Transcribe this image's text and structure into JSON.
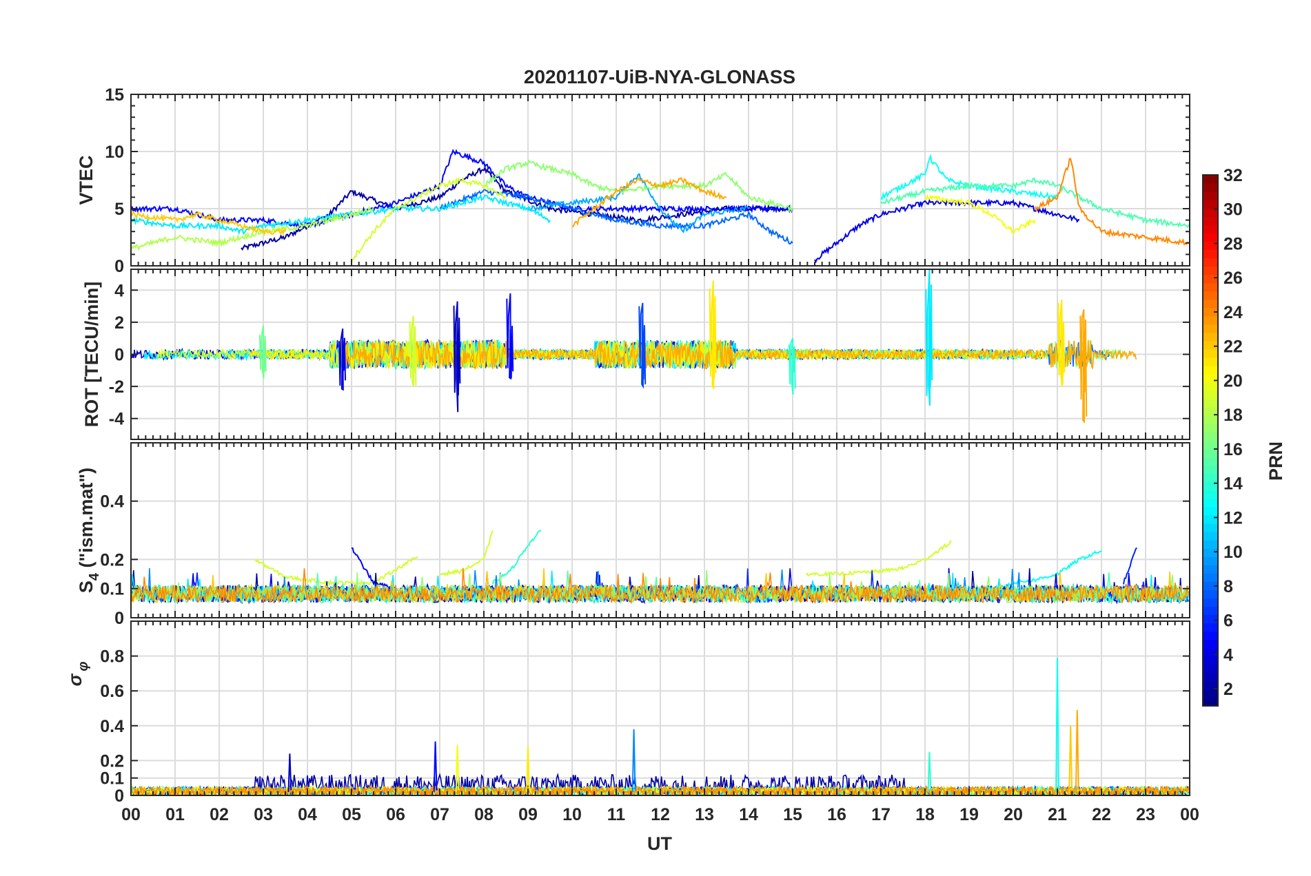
{
  "chart_data": {
    "type": "line",
    "title": "20201107-UiB-NYA-GLONASS",
    "xlabel": "UT",
    "xlim": [
      0,
      24
    ],
    "x_tick_labels": [
      "00",
      "01",
      "02",
      "03",
      "04",
      "05",
      "06",
      "07",
      "08",
      "09",
      "10",
      "11",
      "12",
      "13",
      "14",
      "15",
      "16",
      "17",
      "18",
      "19",
      "20",
      "21",
      "22",
      "23",
      "00"
    ],
    "grid": true,
    "colorbar": {
      "label": "PRN",
      "range": [
        1,
        32
      ],
      "tick_labels": [
        "2",
        "4",
        "6",
        "8",
        "10",
        "12",
        "14",
        "16",
        "18",
        "20",
        "22",
        "24",
        "26",
        "28",
        "30",
        "32"
      ],
      "colormap": "jet",
      "position": "right"
    },
    "panels": [
      {
        "name": "vtec",
        "ylabel": "VTEC",
        "ylim": [
          0,
          15
        ],
        "y_tick_labels": [
          "0",
          "5",
          "10",
          "15"
        ],
        "series": [
          {
            "prn": 2,
            "x": [
              2.5,
              3.5,
              4.5,
              5.0,
              6.0,
              7.0,
              7.5,
              8.0,
              8.5,
              9.5,
              10.5,
              11.5,
              12.5,
              13.5,
              14.5,
              15.0
            ],
            "y": [
              1.5,
              2.5,
              4.5,
              6.5,
              5.0,
              6.0,
              7.5,
              8.5,
              6.5,
              5.0,
              4.5,
              4.0,
              4.5,
              5.0,
              5.0,
              5.0
            ]
          },
          {
            "prn": 4,
            "x": [
              15.5,
              16.0,
              16.5,
              17.0,
              18.0,
              19.0,
              20.0,
              21.0,
              21.5
            ],
            "y": [
              0.5,
              2.0,
              3.5,
              4.5,
              5.5,
              5.5,
              5.5,
              4.5,
              4.0
            ]
          },
          {
            "prn": 5,
            "x": [
              0.0,
              1.0,
              2.0,
              3.0,
              4.0,
              5.0,
              6.0,
              7.0,
              7.3,
              8.0,
              8.5,
              9.0,
              10.0,
              11.0,
              12.0,
              13.0,
              14.0,
              15.0
            ],
            "y": [
              5.0,
              5.0,
              4.0,
              4.0,
              3.5,
              4.5,
              5.5,
              7.0,
              10.0,
              9.0,
              7.0,
              6.0,
              5.0,
              5.0,
              5.0,
              5.0,
              5.0,
              5.0
            ]
          },
          {
            "prn": 8,
            "x": [
              7.0,
              8.0,
              9.0,
              10.0,
              11.0,
              12.0,
              13.0,
              14.0,
              14.5,
              15.0
            ],
            "y": [
              5.0,
              6.5,
              6.0,
              5.0,
              4.0,
              3.5,
              3.5,
              4.5,
              3.0,
              2.0
            ]
          },
          {
            "prn": 10,
            "x": [
              9.0,
              10.0,
              11.0,
              11.5,
              12.0,
              12.5,
              13.0,
              14.0
            ],
            "y": [
              5.0,
              5.5,
              6.0,
              8.0,
              5.0,
              3.0,
              4.5,
              5.0
            ]
          },
          {
            "prn": 12,
            "x": [
              0.0,
              1.0,
              2.0,
              2.5,
              3.0,
              4.0,
              5.0,
              6.0,
              7.0,
              8.0,
              9.0,
              9.5
            ],
            "y": [
              4.0,
              3.5,
              3.5,
              3.0,
              3.5,
              4.0,
              4.5,
              5.0,
              5.0,
              6.0,
              5.0,
              4.0
            ]
          },
          {
            "prn": 13,
            "x": [
              17.0,
              17.5,
              18.0,
              18.1,
              18.5,
              19.0,
              20.0,
              21.0
            ],
            "y": [
              6.0,
              7.0,
              8.0,
              9.5,
              7.5,
              7.0,
              6.5,
              6.0
            ]
          },
          {
            "prn": 15,
            "x": [
              17.0,
              18.0,
              19.0,
              20.0,
              20.5,
              21.0,
              21.5,
              22.0,
              23.0,
              24.0
            ],
            "y": [
              5.5,
              6.5,
              7.0,
              7.0,
              7.5,
              7.0,
              6.0,
              5.0,
              4.0,
              3.5
            ]
          },
          {
            "prn": 17,
            "x": [
              8.0,
              8.5,
              9.0,
              10.0,
              10.5,
              11.0,
              12.0,
              13.0,
              13.5,
              14.0,
              15.0
            ],
            "y": [
              7.0,
              8.5,
              9.0,
              8.0,
              7.0,
              6.5,
              7.0,
              7.0,
              8.0,
              6.0,
              5.0
            ]
          },
          {
            "prn": 18,
            "x": [
              0.0,
              1.0,
              2.0,
              3.0,
              4.0,
              5.0,
              5.5
            ],
            "y": [
              1.5,
              2.5,
              2.0,
              3.0,
              3.5,
              4.5,
              5.0
            ]
          },
          {
            "prn": 19,
            "x": [
              5.0,
              5.5,
              6.0,
              6.5,
              7.0,
              7.5,
              8.0,
              8.5
            ],
            "y": [
              0.5,
              3.0,
              5.0,
              6.0,
              7.0,
              7.5,
              7.0,
              6.0
            ]
          },
          {
            "prn": 20,
            "x": [
              18.0,
              19.0,
              19.5,
              20.0,
              20.5
            ],
            "y": [
              6.0,
              5.5,
              4.5,
              3.0,
              4.0
            ]
          },
          {
            "prn": 22,
            "x": [
              0.0,
              1.0,
              1.5,
              2.0,
              2.5,
              3.0,
              3.5
            ],
            "y": [
              4.5,
              4.0,
              4.5,
              4.0,
              3.5,
              3.0,
              3.0
            ]
          },
          {
            "prn": 23,
            "x": [
              10.0,
              11.0,
              11.5,
              12.0,
              12.5,
              13.0,
              13.5
            ],
            "y": [
              3.5,
              6.5,
              7.5,
              7.0,
              7.5,
              6.5,
              6.0
            ]
          },
          {
            "prn": 24,
            "x": [
              20.5,
              21.0,
              21.3,
              21.5,
              22.0,
              23.0,
              24.0
            ],
            "y": [
              5.0,
              6.0,
              9.5,
              5.0,
              3.0,
              2.5,
              2.0
            ]
          }
        ]
      },
      {
        "name": "rot",
        "ylabel": "ROT [TECU/min]",
        "ylim": [
          -5.3,
          5.3
        ],
        "y_tick_labels": [
          "-4",
          "-2",
          "0",
          "2",
          "4"
        ],
        "spikes": [
          {
            "prn": 3,
            "x": 7.4,
            "max": 3.3,
            "min": -3.6
          },
          {
            "prn": 5,
            "x": 8.6,
            "max": 3.8,
            "min": -1.5
          },
          {
            "prn": 4,
            "x": 4.8,
            "max": 1.6,
            "min": -2.2
          },
          {
            "prn": 7,
            "x": 11.6,
            "max": 3.2,
            "min": -2.0
          },
          {
            "prn": 12,
            "x": 18.1,
            "max": 5.3,
            "min": -3.2
          },
          {
            "prn": 21,
            "x": 13.2,
            "max": 4.6,
            "min": -2.1
          },
          {
            "prn": 23,
            "x": 21.6,
            "max": 2.8,
            "min": -4.2
          },
          {
            "prn": 21,
            "x": 21.1,
            "max": 3.4,
            "min": -2.0
          },
          {
            "prn": 19,
            "x": 6.4,
            "max": 2.4,
            "min": -2.0
          },
          {
            "prn": 16,
            "x": 3.0,
            "max": 1.8,
            "min": -1.5
          },
          {
            "prn": 14,
            "x": 15.0,
            "max": 1.0,
            "min": -2.5
          }
        ],
        "noise_level": 0.3
      },
      {
        "name": "s4",
        "ylabel": "S4 (\"ism.mat\")",
        "ylim": [
          0,
          0.6
        ],
        "y_tick_labels": [
          "0",
          "0.1",
          "0.2",
          "0.4"
        ],
        "series": [
          {
            "prn": 19,
            "x": [
              2.8,
              3.5,
              4.5,
              5.5,
              6.5
            ],
            "y": [
              0.2,
              0.14,
              0.12,
              0.12,
              0.21
            ]
          },
          {
            "prn": 19,
            "x": [
              7.0,
              7.5,
              8.0,
              8.2
            ],
            "y": [
              0.15,
              0.16,
              0.2,
              0.3
            ]
          },
          {
            "prn": 14,
            "x": [
              8.2,
              8.6,
              9.0,
              9.3
            ],
            "y": [
              0.12,
              0.16,
              0.25,
              0.3
            ]
          },
          {
            "prn": 19,
            "x": [
              15.3,
              16.0,
              17.0,
              17.5,
              18.0,
              18.6
            ],
            "y": [
              0.15,
              0.15,
              0.16,
              0.17,
              0.2,
              0.26
            ]
          },
          {
            "prn": 13,
            "x": [
              19.0,
              19.5,
              20.0,
              20.5,
              21.0,
              21.5,
              22.0
            ],
            "y": [
              0.1,
              0.09,
              0.12,
              0.13,
              0.15,
              0.2,
              0.23
            ]
          },
          {
            "prn": 5,
            "x": [
              5.0,
              5.5,
              6.0
            ],
            "y": [
              0.24,
              0.12,
              0.1
            ]
          },
          {
            "prn": 6,
            "x": [
              22.5,
              22.8
            ],
            "y": [
              0.12,
              0.24
            ]
          }
        ],
        "base_level": 0.07
      },
      {
        "name": "sigma_phi",
        "ylabel": "σ φ",
        "ylim": [
          0,
          1.0
        ],
        "y_tick_labels": [
          "0",
          "0.1",
          "0.2",
          "0.4",
          "0.6",
          "0.8"
        ],
        "spikes": [
          {
            "prn": 13,
            "x": 21.0,
            "max": 0.79
          },
          {
            "prn": 23,
            "x": 21.45,
            "max": 0.49
          },
          {
            "prn": 22,
            "x": 21.3,
            "max": 0.4
          },
          {
            "prn": 9,
            "x": 11.4,
            "max": 0.38
          },
          {
            "prn": 5,
            "x": 6.9,
            "max": 0.31
          },
          {
            "prn": 20,
            "x": 7.4,
            "max": 0.29
          },
          {
            "prn": 21,
            "x": 9.0,
            "max": 0.28
          },
          {
            "prn": 14,
            "x": 18.1,
            "max": 0.25
          },
          {
            "prn": 3,
            "x": 3.6,
            "max": 0.24
          }
        ],
        "base_level": 0.05
      }
    ]
  }
}
